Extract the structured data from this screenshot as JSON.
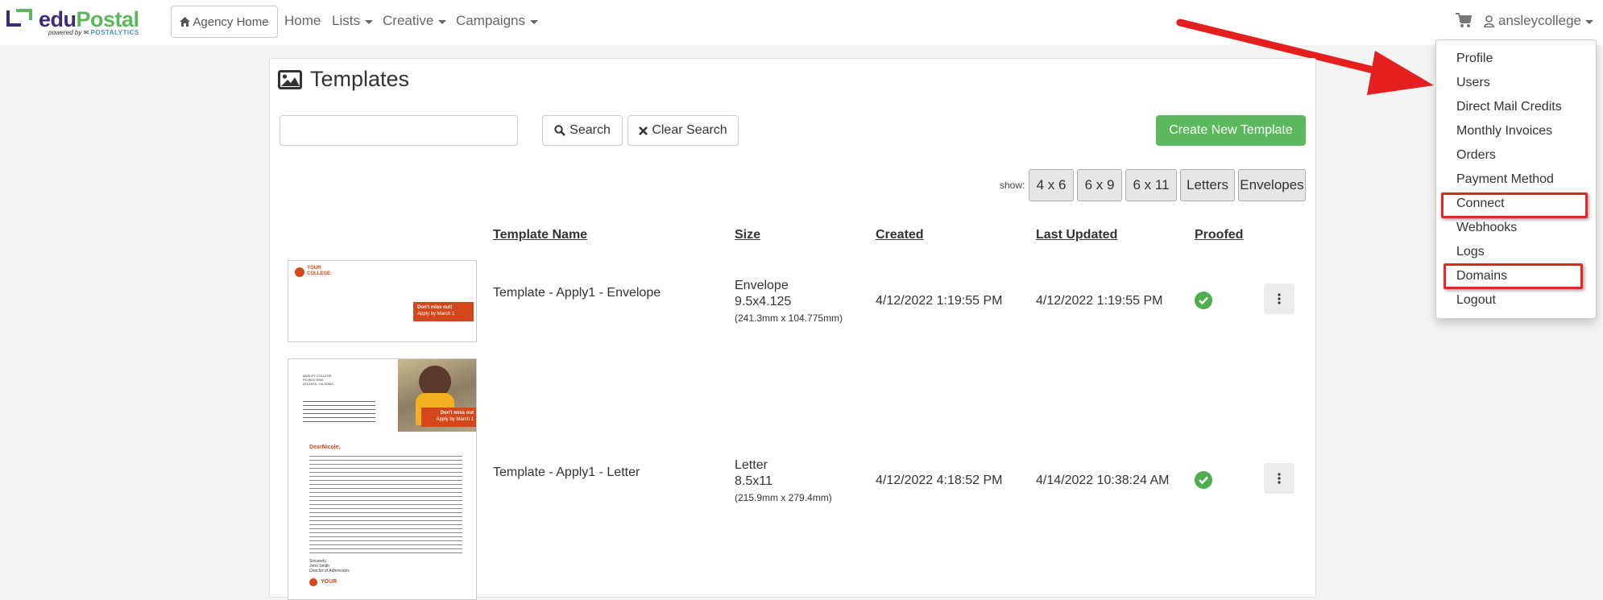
{
  "brand": {
    "name_part1": "edu",
    "name_part2": "Postal",
    "powered_by": "powered by",
    "partner": "POSTALYTICS",
    "green": "#5cb85c",
    "purple": "#3d2b7a"
  },
  "nav": {
    "agency_home": "Agency Home",
    "home": "Home",
    "lists": "Lists",
    "creative": "Creative",
    "campaigns": "Campaigns",
    "user": "ansleycollege"
  },
  "dropdown": {
    "items": [
      "Profile",
      "Users",
      "Direct Mail Credits",
      "Monthly Invoices",
      "Orders",
      "Payment Method",
      "Connect",
      "Webhooks",
      "Logs",
      "Domains",
      "Logout"
    ],
    "highlighted": [
      "Connect",
      "Domains"
    ],
    "highlight_color": "#e32626"
  },
  "page": {
    "title": "Templates",
    "search_placeholder": "",
    "search_button": "Search",
    "clear_button": "Clear Search",
    "create_button": "Create New Template",
    "show_label": "show:",
    "filters": [
      "4 x 6",
      "6 x 9",
      "6 x 11",
      "Letters",
      "Envelopes"
    ]
  },
  "table": {
    "headers": [
      "Template Name",
      "Size",
      "Created",
      "Last Updated",
      "Proofed"
    ],
    "rows": [
      {
        "name": "Template - Apply1 - Envelope",
        "size_type": "Envelope",
        "size_in": "9.5x4.125",
        "size_mm": "(241.3mm x 104.775mm)",
        "created": "4/12/2022 1:19:55 PM",
        "updated": "4/12/2022 1:19:55 PM",
        "proofed": true
      },
      {
        "name": "Template - Apply1 - Letter",
        "size_type": "Letter",
        "size_in": "8.5x11",
        "size_mm": "(215.9mm x 279.4mm)",
        "created": "4/12/2022 4:18:52 PM",
        "updated": "4/14/2022 10:38:24 AM",
        "proofed": true
      }
    ]
  },
  "thumbs": {
    "env_logo_1": "YOUR",
    "env_logo_2": "COLLEGE",
    "env_cta_1": "Don't miss out!",
    "env_cta_2": "Apply by March 1",
    "letter_cta_1": "Don't miss out",
    "letter_cta_2": "Apply by March 1",
    "letter_greeting": "DearNicole,",
    "letter_addr_1": "ANSLEY COLLEGE",
    "letter_addr_2": "PO BOX 9000",
    "letter_addr_3": "ATLANTA, GA 30303",
    "letter_sig_1": "Sincerely,",
    "letter_sig_2": "John Smith",
    "letter_sig_3": "Director of Admissions",
    "letter_logo": "YOUR",
    "accent": "#d4471c"
  }
}
